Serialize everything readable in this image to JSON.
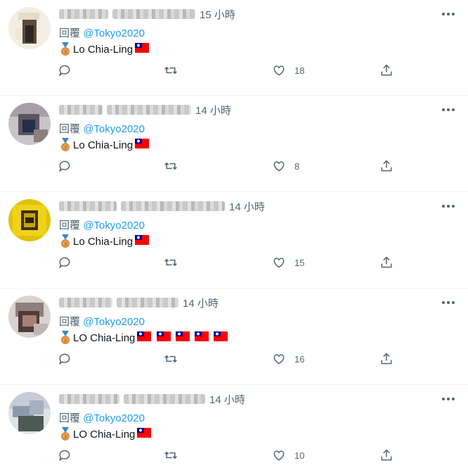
{
  "tweets": [
    {
      "time": "15 小時",
      "reply_prefix": "回覆",
      "reply_handle": "@Tokyo2020",
      "text": "Lo Chia-Ling",
      "flags": 1,
      "likes": "18",
      "avatar": "blurred-avatar-1"
    },
    {
      "time": "14 小時",
      "reply_prefix": "回覆",
      "reply_handle": "@Tokyo2020",
      "text": "Lo Chia-Ling",
      "flags": 1,
      "likes": "8",
      "avatar": "blurred-avatar-2"
    },
    {
      "time": "14 小時",
      "reply_prefix": "回覆",
      "reply_handle": "@Tokyo2020",
      "text": "Lo Chia-Ling",
      "flags": 1,
      "likes": "15",
      "avatar": "blurred-avatar-3"
    },
    {
      "time": "14 小時",
      "reply_prefix": "回覆",
      "reply_handle": "@Tokyo2020",
      "text": "LO Chia-Ling",
      "flags": 5,
      "likes": "16",
      "avatar": "blurred-avatar-4"
    },
    {
      "time": "14 小時",
      "reply_prefix": "回覆",
      "reply_handle": "@Tokyo2020",
      "text": "LO Chia-Ling",
      "flags": 1,
      "likes": "10",
      "avatar": "blurred-avatar-5"
    }
  ],
  "colors": {
    "link": "#1d9bf0",
    "secondary": "#536471",
    "text": "#0f1419"
  },
  "icons": [
    "reply-icon",
    "retweet-icon",
    "like-icon",
    "share-icon",
    "more-icon",
    "bronze-medal-icon",
    "taiwan-flag-icon"
  ]
}
